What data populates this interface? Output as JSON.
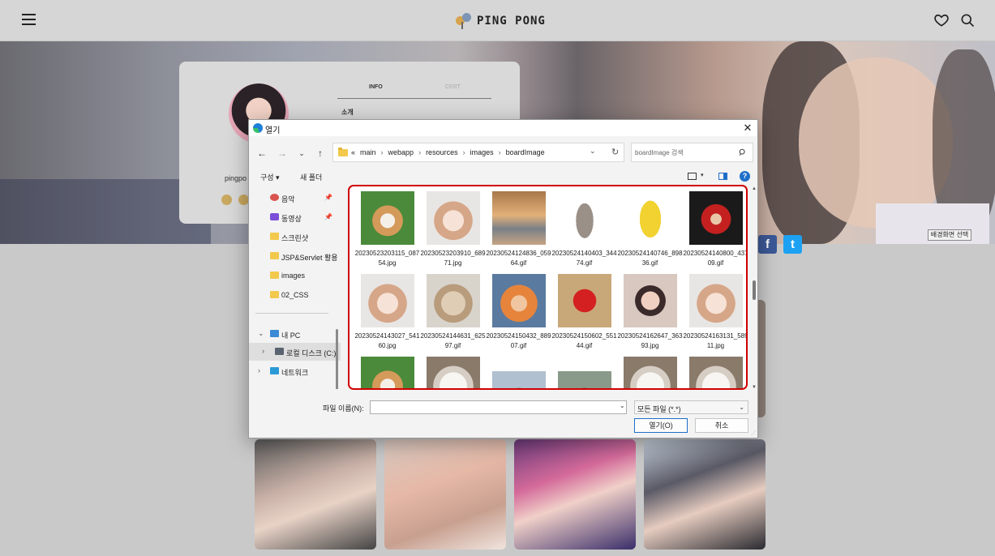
{
  "site": {
    "logo_text": "PING PONG",
    "nickname": "pingpo",
    "tab_info": "INFO",
    "tab_cert": "CERT",
    "intro_label": "소개",
    "bg_select_button": "배경화면 선택",
    "facebook_glyph": "f",
    "twitter_glyph": "t"
  },
  "dialog": {
    "title": "열기",
    "close_glyph": "✕",
    "nav": {
      "back": "←",
      "forward": "→",
      "recent": "⌄",
      "up": "↑"
    },
    "address": {
      "prefix": "«",
      "crumbs": [
        "main",
        "webapp",
        "resources",
        "images",
        "boardImage"
      ],
      "separator": "›",
      "dropdown_glyph": "⌄",
      "refresh_glyph": "↻"
    },
    "search": {
      "placeholder": "boardImage 검색"
    },
    "toolbar": {
      "organize": "구성 ▾",
      "new_folder": "새 폴더",
      "view_drop": "▾",
      "help": "?"
    },
    "nav_pane": {
      "items": [
        {
          "label": "음악",
          "icon": "music-icon",
          "pinned": true
        },
        {
          "label": "동영상",
          "icon": "video-icon",
          "pinned": true
        },
        {
          "label": "스크린샷",
          "icon": "folder-icon",
          "pinned": false
        },
        {
          "label": "JSP&Servlet 활용",
          "icon": "folder-icon",
          "pinned": false
        },
        {
          "label": "images",
          "icon": "folder-icon",
          "pinned": false
        },
        {
          "label": "02_CSS",
          "icon": "folder-icon",
          "pinned": false
        }
      ],
      "pin_glyph": "📌",
      "this_pc": {
        "label": "내 PC",
        "chevron": "⌄"
      },
      "local_disk": {
        "label": "로컬 디스크 (C:)",
        "chevron": "›"
      },
      "network": {
        "label": "네트워크",
        "chevron": "›"
      }
    },
    "files": [
      {
        "name": "20230523203115_08754.jpg",
        "thumb": "dog"
      },
      {
        "name": "20230523203910_68971.jpg",
        "thumb": "hamster"
      },
      {
        "name": "20230524124836_05964.gif",
        "thumb": "cat-laptop"
      },
      {
        "name": "20230524140403_34474.gif",
        "thumb": "cat-dance"
      },
      {
        "name": "20230524140746_89836.gif",
        "thumb": "banana-cat"
      },
      {
        "name": "20230524140800_43709.gif",
        "thumb": "apple-cat"
      },
      {
        "name": "20230524143027_54160.jpg",
        "thumb": "hamster"
      },
      {
        "name": "20230524144631_62597.gif",
        "thumb": "pop-cat"
      },
      {
        "name": "20230524150432_88907.gif",
        "thumb": "cute-cat"
      },
      {
        "name": "20230524150602_55144.gif",
        "thumb": "elmo"
      },
      {
        "name": "20230524162647_36393.jpg",
        "thumb": "girl"
      },
      {
        "name": "20230524163131_58911.jpg",
        "thumb": "hamster"
      },
      {
        "name": "",
        "thumb": "dog"
      },
      {
        "name": "",
        "thumb": "white-dog"
      },
      {
        "name": "",
        "thumb": "man"
      },
      {
        "name": "",
        "thumb": "man"
      },
      {
        "name": "",
        "thumb": "white-dog"
      },
      {
        "name": "",
        "thumb": "white-dog"
      }
    ],
    "filename_label": "파일 이름(N):",
    "filename_value": "",
    "filename_dropdown": "⌄",
    "filetype": {
      "value": "모든 파일 (*.*)",
      "arrow": "⌄"
    },
    "open_button": "열기(O)",
    "cancel_button": "취소",
    "scroll_up": "▲",
    "scroll_down": "▼",
    "grip_glyph": "⋰"
  },
  "colors": {
    "selection_outline": "#d00000",
    "accent": "#1e6fc8"
  }
}
